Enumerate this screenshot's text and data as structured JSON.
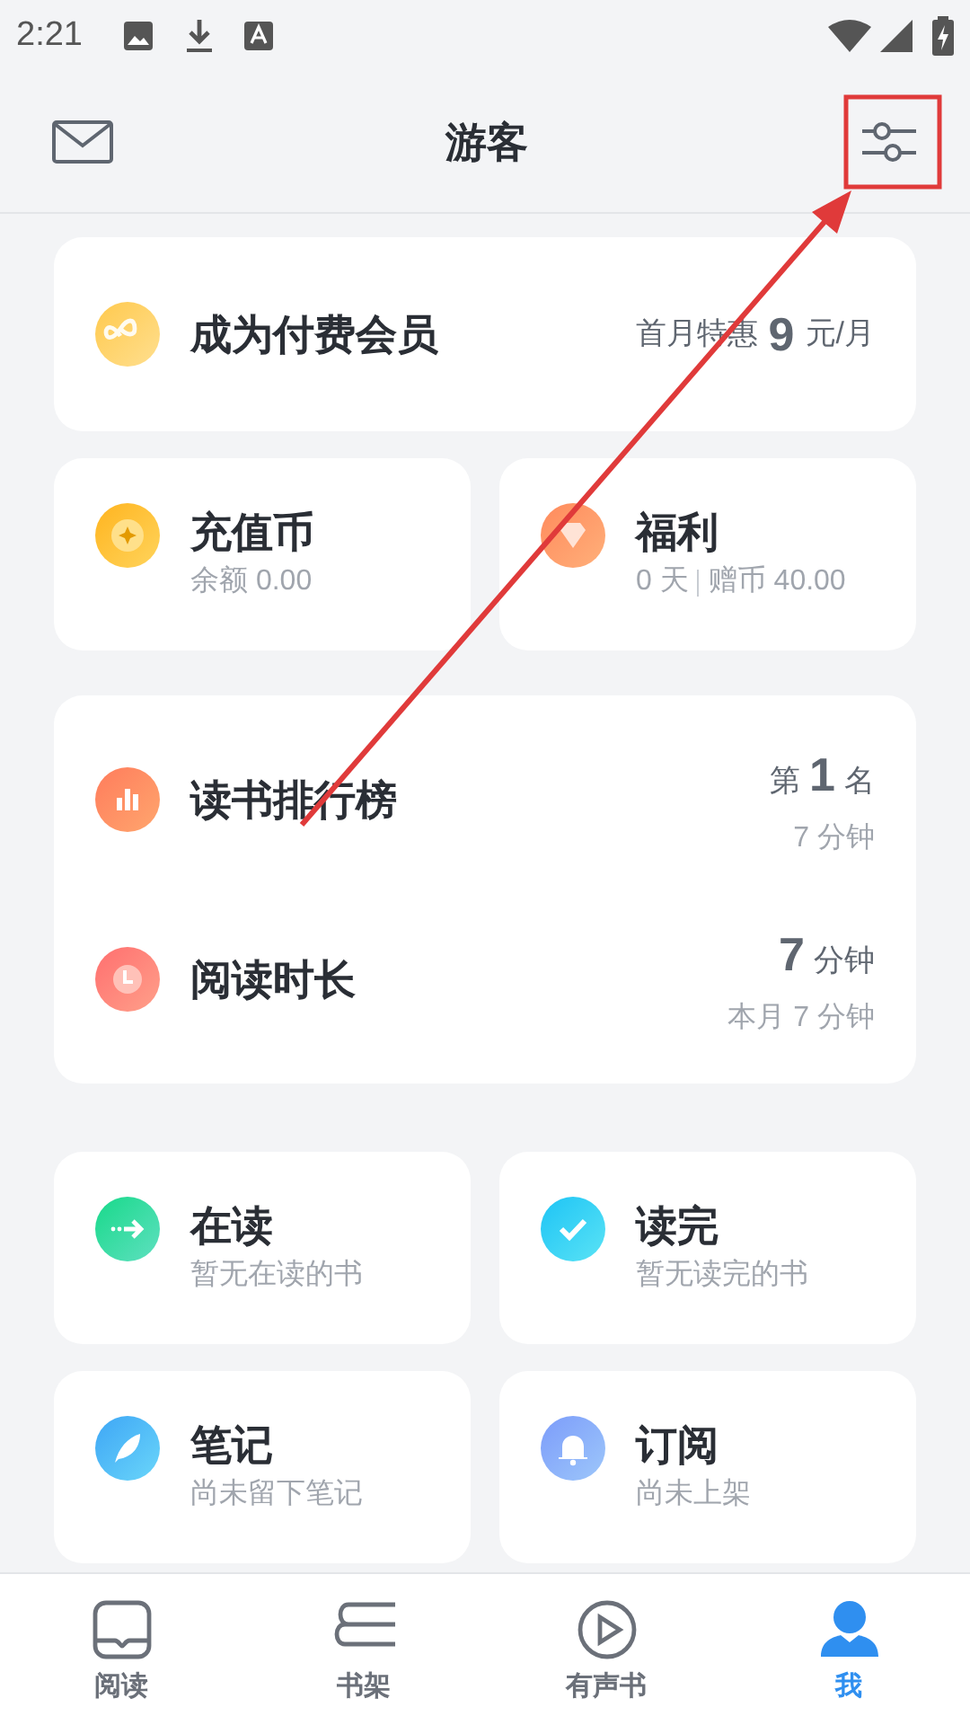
{
  "status_bar": {
    "time": "2:21"
  },
  "header": {
    "title": "游客"
  },
  "membership": {
    "title": "成为付费会员",
    "price_prefix": "首月特惠",
    "price_value": "9",
    "price_suffix": "元/月"
  },
  "wallet": [
    {
      "kind": "coin",
      "title": "充值币",
      "subtitle": "余额 0.00"
    },
    {
      "kind": "gift",
      "title": "福利",
      "subtitle_parts": [
        "0 天",
        "赠币 40.00"
      ]
    }
  ],
  "stats": [
    {
      "kind": "rank",
      "title": "读书排行榜",
      "value_prefix": "第",
      "value": "1",
      "value_suffix": "名",
      "detail": "7 分钟"
    },
    {
      "kind": "time",
      "title": "阅读时长",
      "value": "7",
      "value_suffix": "分钟",
      "detail": "本月 7 分钟"
    }
  ],
  "shelves": [
    {
      "kind": "reading",
      "title": "在读",
      "subtitle": "暂无在读的书"
    },
    {
      "kind": "finished",
      "title": "读完",
      "subtitle": "暂无读完的书"
    },
    {
      "kind": "notes",
      "title": "笔记",
      "subtitle": "尚未留下笔记"
    },
    {
      "kind": "subscribe",
      "title": "订阅",
      "subtitle": "尚未上架"
    }
  ],
  "tab_bar": [
    {
      "kind": "read",
      "label": "阅读",
      "selected": false
    },
    {
      "kind": "shelf",
      "label": "书架",
      "selected": false
    },
    {
      "kind": "audio",
      "label": "有声书",
      "selected": false
    },
    {
      "kind": "me",
      "label": "我",
      "selected": true
    }
  ],
  "annotation": {
    "kind": "arrow_to_box"
  }
}
